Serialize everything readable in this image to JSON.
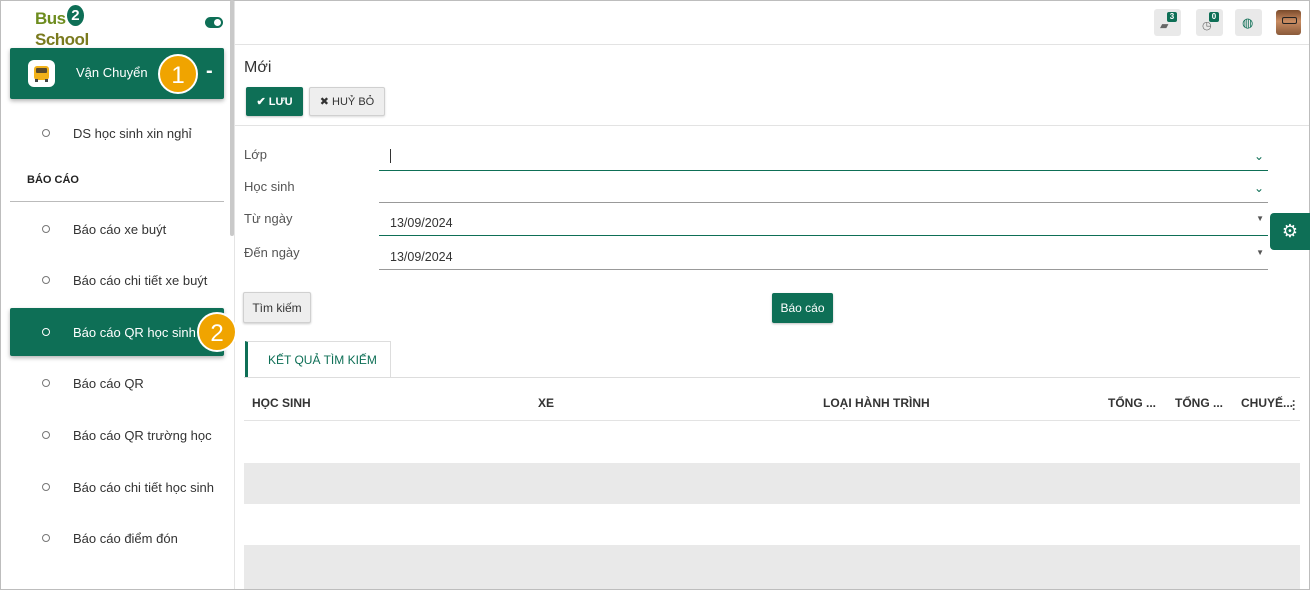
{
  "sidebar": {
    "logo_part1": "Bus",
    "logo_part2": "2",
    "logo_part3": "School",
    "module_label": "Vận Chuyển",
    "collapse_symbol": "-",
    "item_top": "DS học sinh xin nghỉ",
    "section_title": "BÁO CÁO",
    "items": [
      "Báo cáo xe buýt",
      "Báo cáo chi tiết xe buýt",
      "Báo cáo QR học sinh",
      "Báo cáo QR",
      "Báo cáo QR trường học",
      "Báo cáo chi tiết học sinh",
      "Báo cáo điểm đón"
    ],
    "active_item": "Báo cáo QR học sinh"
  },
  "annotations": {
    "badge1": "1",
    "badge2": "2"
  },
  "topbar": {
    "messages_count": "3",
    "activity_count": "0"
  },
  "form": {
    "title": "Mới",
    "save_label": "LƯU",
    "cancel_label": "HUỶ BỎ",
    "fields": [
      {
        "label": "Lớp",
        "value": ""
      },
      {
        "label": "Học sinh",
        "value": ""
      },
      {
        "label": "Từ ngày",
        "value": "13/09/2024"
      },
      {
        "label": "Đến ngày",
        "value": "13/09/2024"
      }
    ],
    "search_label": "Tìm kiếm",
    "report_label": "Báo cáo"
  },
  "results": {
    "tab_label": "KẾT QUẢ TÌM KIẾM",
    "columns": [
      "HỌC SINH",
      "XE",
      "LOẠI HÀNH TRÌNH",
      "TỔNG ...",
      "TỔNG ...",
      "CHUYẾ..."
    ]
  },
  "colors": {
    "primary": "#0e6f56",
    "badge": "#f0a400"
  }
}
